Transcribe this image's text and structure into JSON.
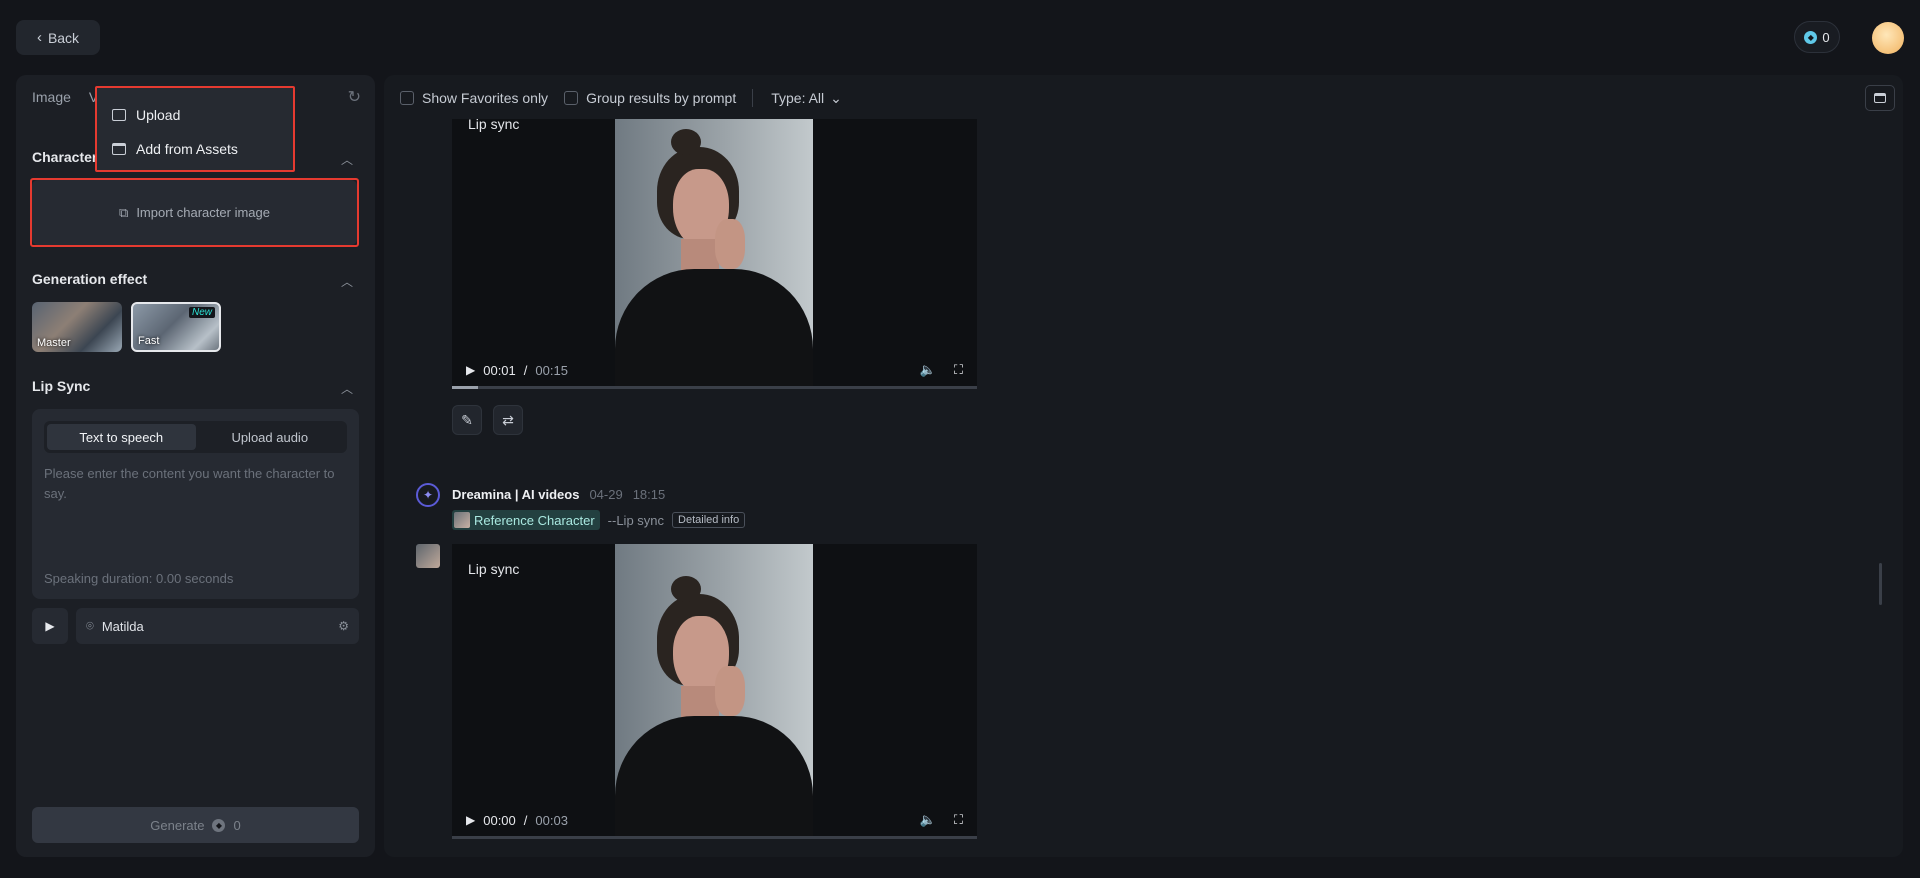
{
  "topbar": {
    "back_label": "Back",
    "credits": "0"
  },
  "left_panel": {
    "tabs": [
      "Image",
      "V"
    ],
    "character": {
      "title": "Character",
      "import_label": "Import character image"
    },
    "generation_effect": {
      "title": "Generation effect",
      "options": [
        {
          "label": "Master",
          "selected": false
        },
        {
          "label": "Fast",
          "badge": "New",
          "selected": true
        }
      ]
    },
    "lip_sync": {
      "title": "Lip Sync",
      "modes": [
        "Text to speech",
        "Upload audio"
      ],
      "active_mode": "Text to speech",
      "placeholder": "Please enter the content you want the character to say.",
      "duration": "Speaking duration: 0.00 seconds",
      "voice": "Matilda"
    },
    "generate_label": "Generate",
    "generate_cost": "0"
  },
  "dropdown": {
    "items": [
      "Upload",
      "Add from Assets"
    ]
  },
  "filters": {
    "favorites": "Show Favorites only",
    "group": "Group results by prompt",
    "type": "Type: All"
  },
  "results": [
    {
      "label": "Lip sync",
      "current": "00:01",
      "duration": "00:15",
      "progress": 0.05
    },
    {
      "author": "Dreamina | AI videos",
      "date": "04-29",
      "time": "18:15",
      "reference": "Reference Character",
      "mode": "--Lip sync",
      "detail": "Detailed info",
      "label": "Lip sync",
      "current": "00:00",
      "duration": "00:03",
      "progress": 0.0
    }
  ],
  "colors": {
    "highlight": "#e53a30",
    "accent": "#2de2d6",
    "background": "#13151a"
  }
}
